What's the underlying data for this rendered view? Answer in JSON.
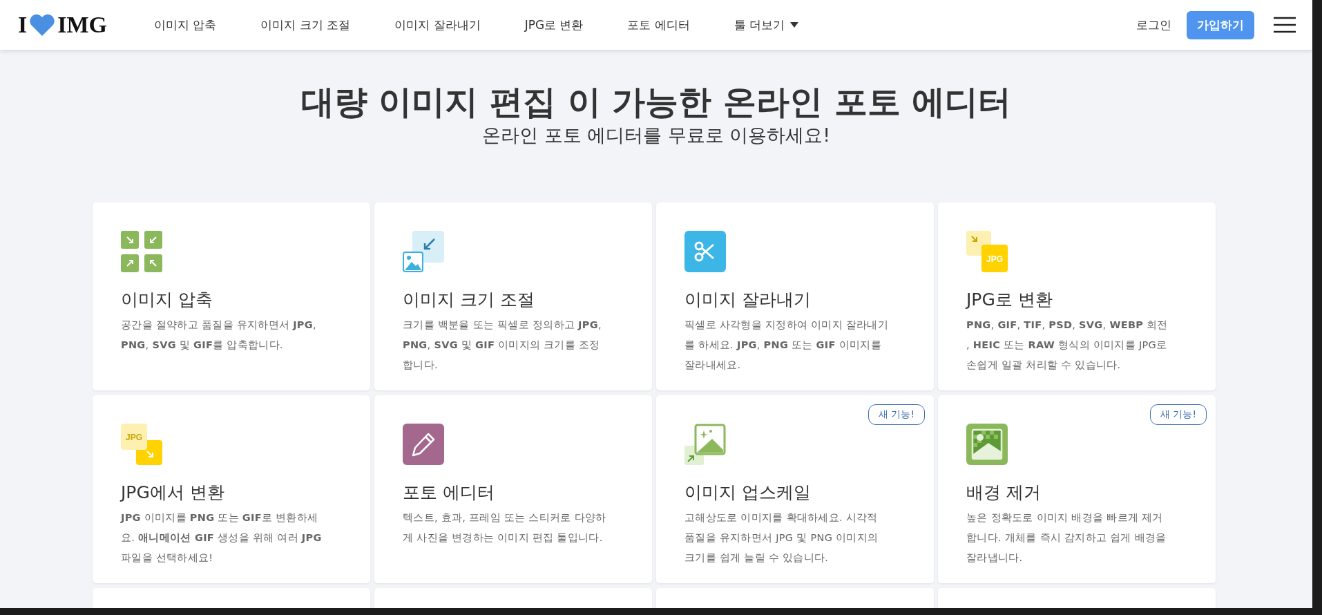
{
  "logo": {
    "left": "I",
    "right": "IMG"
  },
  "nav": [
    {
      "label": "이미지 압축",
      "dropdown": false
    },
    {
      "label": "이미지 크기 조절",
      "dropdown": false
    },
    {
      "label": "이미지 잘라내기",
      "dropdown": false
    },
    {
      "label": "JPG로 변환",
      "dropdown": false
    },
    {
      "label": "포토 에디터",
      "dropdown": false
    },
    {
      "label": "툴 더보기",
      "dropdown": true
    }
  ],
  "login": "로그인",
  "signup": "가입하기",
  "title": "대량 이미지 편집 이 가능한 온라인 포토 에디터",
  "subtitle": "온라인 포토 에디터를 무료로 이용하세요!",
  "tools": [
    {
      "kind": "compress",
      "name": "이미지 압축",
      "description": "공간을 절약하고 품질을 유지하면서 **JPG**, **PNG**, **SVG** 및 **GIF**를 압축합니다."
    },
    {
      "kind": "resize",
      "name": "이미지 크기 조절",
      "description": "크기를 백분율 또는 픽셀로 정의하고 **JPG**, **PNG**, **SVG** 및 **GIF** 이미지의 크기를 조정합니다."
    },
    {
      "kind": "crop",
      "name": "이미지 잘라내기",
      "description": "픽셀로 사각형을 지정하여 이미지 잘라내기를 하세요. **JPG**, **PNG** 또는 **GIF** 이미지를 잘라내세요."
    },
    {
      "kind": "to-jpg",
      "name": "JPG로 변환",
      "icon_label": "JPG",
      "description": "**PNG**, **GIF**, **TIF**, **PSD**, **SVG**, **WEBP** 회전 , **HEIC** 또는 **RAW** 형식의 이미지를 JPG로 손쉽게 일괄 처리할 수 있습니다."
    },
    {
      "kind": "from-jpg",
      "name": "JPG에서 변환",
      "icon_label": "JPG",
      "description": "**JPG** 이미지를 **PNG** 또는 **GIF**로 변환하세요. **애니메이션 GIF** 생성을 위해 여러 **JPG** 파일을 선택하세요!"
    },
    {
      "kind": "editor",
      "name": "포토 에디터",
      "description": "텍스트, 효과, 프레임 또는 스티커로 다양하게 사진을 변경하는 이미지 편집 툴입니다."
    },
    {
      "kind": "upscale",
      "name": "이미지 업스케일",
      "badge": "새 기능!",
      "description": "고해상도로 이미지를 확대하세요. 시각적 품질을 유지하면서 JPG 및 PNG 이미지의 크기를 쉽게 늘릴 수 있습니다."
    },
    {
      "kind": "remove-bg",
      "name": "배경 제거",
      "badge": "새 기능!",
      "description": "높은 정확도로 이미지 배경을 빠르게 제거합니다. 개체를 즉시 감지하고 쉽게 배경을 잘라냅니다."
    },
    {
      "kind": "empty"
    },
    {
      "kind": "empty"
    },
    {
      "kind": "empty"
    },
    {
      "kind": "empty"
    }
  ]
}
